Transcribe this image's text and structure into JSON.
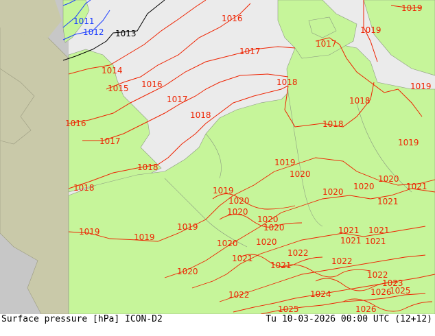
{
  "footer": {
    "left": "Surface pressure [hPa] ICON-D2",
    "right": "Tu 10-03-2026 00:00 UTC (12+12)"
  },
  "colors": {
    "land_domain": "#c6f59a",
    "land_outside": "#c9c9a9",
    "sea_domain": "#ebebeb",
    "sea_outside": "#c7c7c7",
    "isobar_red": "#ee2200",
    "isobar_black": "#000000",
    "isobar_blue": "#1a3cff"
  },
  "isobars": {
    "blue": [
      "1011",
      "1012"
    ],
    "black": [
      "1013"
    ],
    "red_north": [
      "1014",
      "1015",
      "1016",
      "1016",
      "1016",
      "1017",
      "1017",
      "1017",
      "1017",
      "1018",
      "1018",
      "1018",
      "1018",
      "1018",
      "1018",
      "1019",
      "1019"
    ],
    "red_south": [
      "1019",
      "1019",
      "1019",
      "1019",
      "1019",
      "1019",
      "1019",
      "1020",
      "1020",
      "1020",
      "1020",
      "1020",
      "1020",
      "1020",
      "1020",
      "1020",
      "1020",
      "1020",
      "1021",
      "1021",
      "1021",
      "1021",
      "1021",
      "1021",
      "1021",
      "1021",
      "1022",
      "1022",
      "1022",
      "1022",
      "1023",
      "1024",
      "1025",
      "1025",
      "1026",
      "1026"
    ]
  }
}
